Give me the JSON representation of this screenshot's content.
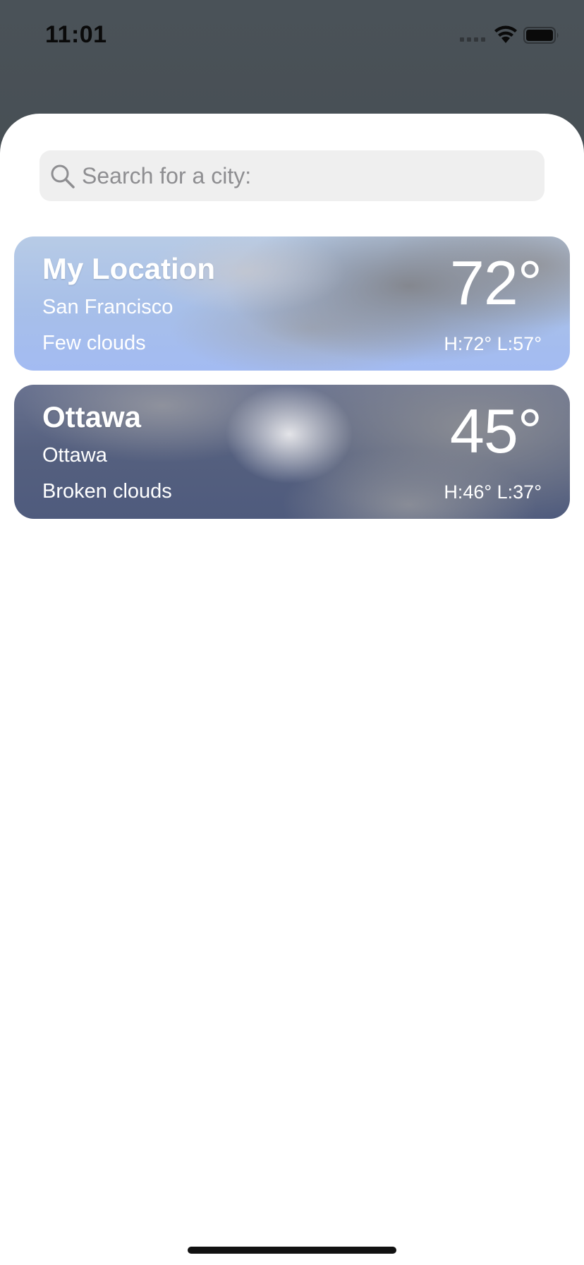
{
  "status_bar": {
    "time": "11:01"
  },
  "search": {
    "placeholder": "Search for a city:",
    "value": ""
  },
  "locations": [
    {
      "title": "My Location",
      "city": "San Francisco",
      "condition": "Few clouds",
      "temperature": "72°",
      "high_low": "H:72° L:57°"
    },
    {
      "title": "Ottawa",
      "city": "Ottawa",
      "condition": "Broken clouds",
      "temperature": "45°",
      "high_low": "H:46° L:37°"
    }
  ],
  "icons": {
    "search": "search-icon",
    "wifi": "wifi-icon",
    "battery": "battery-icon",
    "cellular": "cellular-icon"
  },
  "colors": {
    "sheet_background": "#ffffff",
    "search_field": "#efefef",
    "card_text": "#ffffff"
  }
}
